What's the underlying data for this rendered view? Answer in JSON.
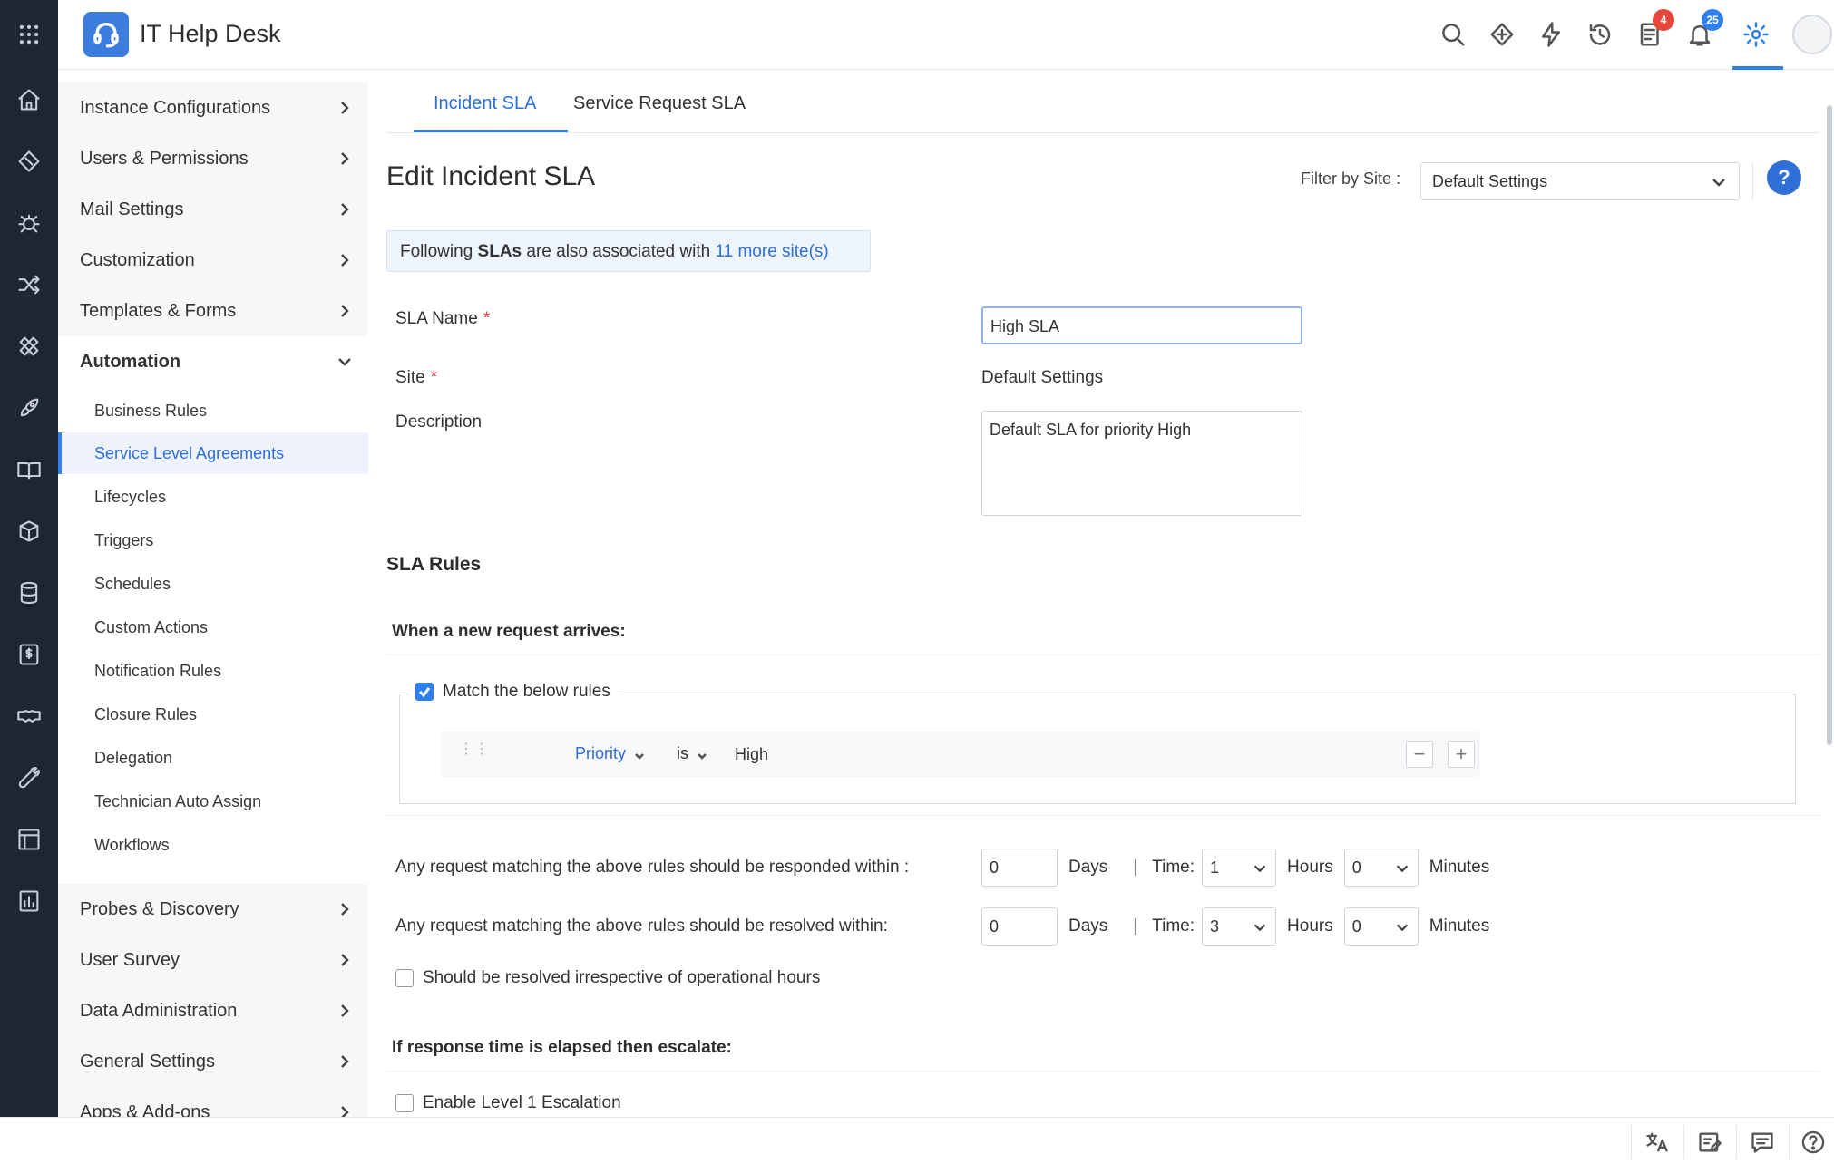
{
  "app": {
    "title": "IT Help Desk"
  },
  "topbar": {
    "icons": [
      "search-icon",
      "diamond-plus-icon",
      "lightning-icon",
      "history-icon",
      "notes-icon",
      "bell-icon",
      "gear-icon",
      "avatar"
    ],
    "badges": {
      "notes": "4",
      "bell": "25"
    },
    "colors": {
      "notes_badge": "#e5473c",
      "bell_badge": "#2f80ed",
      "accent": "#2f80ed"
    }
  },
  "rail": {
    "icons": [
      "apps-grid-icon",
      "home-icon",
      "ticket-icon",
      "bug-icon",
      "shuffle-icon",
      "puzzle-icon",
      "rocket-icon",
      "book-icon",
      "box-icon",
      "database-icon",
      "dollar-icon",
      "handshake-icon",
      "wrench-icon",
      "layout-icon",
      "report-icon"
    ]
  },
  "sidebar": {
    "groups": [
      {
        "label": "Instance Configurations"
      },
      {
        "label": "Users & Permissions"
      },
      {
        "label": "Mail Settings"
      },
      {
        "label": "Customization"
      },
      {
        "label": "Templates & Forms"
      },
      {
        "label": "Automation"
      },
      {
        "label": "Probes & Discovery"
      },
      {
        "label": "User Survey"
      },
      {
        "label": "Data Administration"
      },
      {
        "label": "General Settings"
      },
      {
        "label": "Apps & Add-ons"
      }
    ],
    "automation_items": [
      {
        "label": "Business Rules"
      },
      {
        "label": "Service Level Agreements"
      },
      {
        "label": "Lifecycles"
      },
      {
        "label": "Triggers"
      },
      {
        "label": "Schedules"
      },
      {
        "label": "Custom Actions"
      },
      {
        "label": "Notification Rules"
      },
      {
        "label": "Closure Rules"
      },
      {
        "label": "Delegation"
      },
      {
        "label": "Technician Auto Assign"
      },
      {
        "label": "Workflows"
      }
    ]
  },
  "main": {
    "tabs": [
      {
        "label": "Incident SLA"
      },
      {
        "label": "Service Request SLA"
      }
    ],
    "page_title": "Edit Incident SLA",
    "filter": {
      "label": "Filter by Site :",
      "value": "Default Settings"
    },
    "help": "?",
    "info": {
      "prefix": "Following ",
      "bold": "SLAs",
      "middle": " are also associated with ",
      "link": "11 more site(s)"
    },
    "form": {
      "sla_name_label": "SLA Name",
      "sla_name_value": "High SLA",
      "site_label": "Site",
      "site_value": "Default Settings",
      "description_label": "Description",
      "description_value": "Default SLA for priority High",
      "required_mark": "*"
    },
    "rules": {
      "section_title": "SLA Rules",
      "arrival_title": "When a new request arrives:",
      "match_label": "Match the below rules",
      "match_checked": true,
      "condition": {
        "field": "Priority",
        "operator": "is",
        "value": "High"
      },
      "minus": "−",
      "plus": "+"
    },
    "response": {
      "question": "Any request matching the above rules should be responded within :",
      "days": "0",
      "days_label": "Days",
      "sep": "|",
      "time_label": "Time:",
      "hours": "1",
      "hours_label": "Hours",
      "minutes": "0",
      "minutes_label": "Minutes"
    },
    "resolve": {
      "question": "Any request matching the above rules should be resolved within:",
      "days": "0",
      "days_label": "Days",
      "sep": "|",
      "time_label": "Time:",
      "hours": "3",
      "hours_label": "Hours",
      "minutes": "0",
      "minutes_label": "Minutes"
    },
    "irrespective_label": "Should be resolved irrespective of operational hours",
    "escalation_title": "If response time is elapsed then escalate:",
    "enable_level1": "Enable Level 1 Escalation"
  },
  "bottombar": {
    "icons": [
      "translate-icon",
      "notes-edit-icon",
      "chat-icon",
      "help-circle-icon"
    ]
  }
}
